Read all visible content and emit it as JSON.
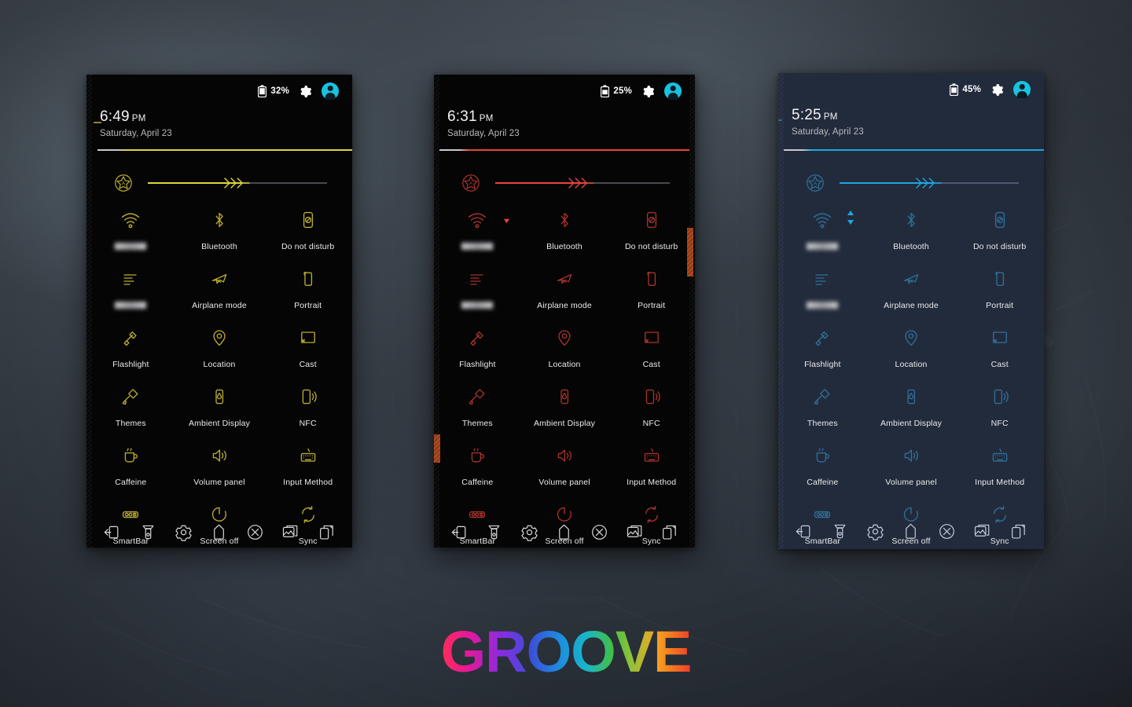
{
  "wallpaper": {
    "base_color": "#3b444b",
    "description": "blurred dark blue-grey foliage"
  },
  "brand": {
    "text": "GROOVE",
    "gradient_stops": [
      "#ff2d55",
      "#e5189a",
      "#8a2be2",
      "#3b4fd8",
      "#1b8fe0",
      "#19b6c9",
      "#3fbf4a",
      "#8fc23a",
      "#f5a623",
      "#f26a21",
      "#ef3b2c"
    ]
  },
  "panels": [
    {
      "id": "panel-yellow",
      "accent": "#ddd63a",
      "icon_color": "#b9ac2e",
      "background": "#050505",
      "statusbar": {
        "battery_percent": "32%",
        "battery_icon": "battery-icon",
        "gear_icon": "gear-icon",
        "avatar_icon": "user-avatar-icon",
        "avatar_color": "#17c3e0"
      },
      "clock": {
        "time": "6:49",
        "ampm": "PM",
        "date": "Saturday, April 23"
      },
      "brightness": {
        "auto_icon": "auto-brightness-star-icon",
        "fill_percent": 52,
        "thumb_icon": "arrow-thumb-icon"
      },
      "tiles": [
        [
          {
            "label": "",
            "redacted": true,
            "icon": "wifi-icon"
          },
          {
            "label": "Bluetooth",
            "icon": "bluetooth-icon"
          },
          {
            "label": "Do not disturb",
            "icon": "do-not-disturb-icon"
          }
        ],
        [
          {
            "label": "",
            "redacted": true,
            "icon": "mobile-data-icon"
          },
          {
            "label": "Airplane mode",
            "icon": "airplane-icon"
          },
          {
            "label": "Portrait",
            "icon": "portrait-rotation-icon"
          }
        ],
        [
          {
            "label": "Flashlight",
            "icon": "flashlight-icon"
          },
          {
            "label": "Location",
            "icon": "location-pin-icon"
          },
          {
            "label": "Cast",
            "icon": "cast-icon"
          }
        ],
        [
          {
            "label": "Themes",
            "icon": "themes-brush-icon"
          },
          {
            "label": "Ambient Display",
            "icon": "ambient-display-icon"
          },
          {
            "label": "NFC",
            "icon": "nfc-icon"
          }
        ],
        [
          {
            "label": "Caffeine",
            "icon": "caffeine-cup-icon"
          },
          {
            "label": "Volume panel",
            "icon": "volume-icon"
          },
          {
            "label": "Input Method",
            "icon": "keyboard-icon"
          }
        ],
        [
          {
            "label": "SmartBar",
            "icon": "smartbar-icon"
          },
          {
            "label": "Screen off",
            "icon": "screen-off-icon"
          },
          {
            "label": "Sync",
            "icon": "sync-icon"
          }
        ]
      ],
      "navbar": [
        "back-icon",
        "flashlight-nav-icon",
        "gear-nav-icon",
        "home-icon",
        "close-x-icon",
        "gallery-icon",
        "recents-icon"
      ]
    },
    {
      "id": "panel-red",
      "accent": "#e8453c",
      "icon_color": "#a6322c",
      "background": "#050505",
      "statusbar": {
        "battery_percent": "25%",
        "battery_icon": "battery-icon",
        "gear_icon": "gear-icon",
        "avatar_icon": "user-avatar-icon",
        "avatar_color": "#17c3e0"
      },
      "clock": {
        "time": "6:31",
        "ampm": "PM",
        "date": "Saturday, April 23"
      },
      "brightness": {
        "auto_icon": "auto-brightness-star-icon",
        "fill_percent": 52,
        "thumb_icon": "arrow-thumb-icon"
      },
      "tiles": [
        [
          {
            "label": "",
            "redacted": true,
            "icon": "wifi-icon"
          },
          {
            "label": "Bluetooth",
            "icon": "bluetooth-icon"
          },
          {
            "label": "Do not disturb",
            "icon": "do-not-disturb-icon"
          }
        ],
        [
          {
            "label": "",
            "redacted": true,
            "icon": "mobile-data-icon"
          },
          {
            "label": "Airplane mode",
            "icon": "airplane-icon"
          },
          {
            "label": "Portrait",
            "icon": "portrait-rotation-icon"
          }
        ],
        [
          {
            "label": "Flashlight",
            "icon": "flashlight-icon"
          },
          {
            "label": "Location",
            "icon": "location-pin-icon"
          },
          {
            "label": "Cast",
            "icon": "cast-icon"
          }
        ],
        [
          {
            "label": "Themes",
            "icon": "themes-brush-icon"
          },
          {
            "label": "Ambient Display",
            "icon": "ambient-display-icon"
          },
          {
            "label": "NFC",
            "icon": "nfc-icon"
          }
        ],
        [
          {
            "label": "Caffeine",
            "icon": "caffeine-cup-icon"
          },
          {
            "label": "Volume panel",
            "icon": "volume-icon"
          },
          {
            "label": "Input Method",
            "icon": "keyboard-icon"
          }
        ],
        [
          {
            "label": "SmartBar",
            "icon": "smartbar-icon"
          },
          {
            "label": "Screen off",
            "icon": "screen-off-icon"
          },
          {
            "label": "Sync",
            "icon": "sync-icon"
          }
        ]
      ],
      "navbar": [
        "back-icon",
        "flashlight-nav-icon",
        "gear-nav-icon",
        "home-icon",
        "close-x-icon",
        "gallery-icon",
        "recents-icon"
      ]
    },
    {
      "id": "panel-blue",
      "accent": "#1fa6e0",
      "icon_color": "#2f6f98",
      "background": "#222b3c",
      "statusbar": {
        "battery_percent": "45%",
        "battery_icon": "battery-icon",
        "gear_icon": "gear-icon",
        "avatar_icon": "user-avatar-icon",
        "avatar_color": "#17c3e0"
      },
      "clock": {
        "time": "5:25",
        "ampm": "PM",
        "date": "Saturday, April 23"
      },
      "brightness": {
        "auto_icon": "auto-brightness-star-icon",
        "fill_percent": 52,
        "thumb_icon": "arrow-thumb-icon"
      },
      "tiles": [
        [
          {
            "label": "",
            "redacted": true,
            "icon": "wifi-icon"
          },
          {
            "label": "Bluetooth",
            "icon": "bluetooth-icon"
          },
          {
            "label": "Do not disturb",
            "icon": "do-not-disturb-icon"
          }
        ],
        [
          {
            "label": "",
            "redacted": true,
            "icon": "mobile-data-icon"
          },
          {
            "label": "Airplane mode",
            "icon": "airplane-icon"
          },
          {
            "label": "Portrait",
            "icon": "portrait-rotation-icon"
          }
        ],
        [
          {
            "label": "Flashlight",
            "icon": "flashlight-icon"
          },
          {
            "label": "Location",
            "icon": "location-pin-icon"
          },
          {
            "label": "Cast",
            "icon": "cast-icon"
          }
        ],
        [
          {
            "label": "Themes",
            "icon": "themes-brush-icon"
          },
          {
            "label": "Ambient Display",
            "icon": "ambient-display-icon"
          },
          {
            "label": "NFC",
            "icon": "nfc-icon"
          }
        ],
        [
          {
            "label": "Caffeine",
            "icon": "caffeine-cup-icon"
          },
          {
            "label": "Volume panel",
            "icon": "volume-icon"
          },
          {
            "label": "Input Method",
            "icon": "keyboard-icon"
          }
        ],
        [
          {
            "label": "SmartBar",
            "icon": "smartbar-icon"
          },
          {
            "label": "Screen off",
            "icon": "screen-off-icon"
          },
          {
            "label": "Sync",
            "icon": "sync-icon"
          }
        ]
      ],
      "navbar": [
        "back-icon",
        "flashlight-nav-icon",
        "gear-nav-icon",
        "home-icon",
        "close-x-icon",
        "gallery-icon",
        "recents-icon"
      ]
    }
  ]
}
